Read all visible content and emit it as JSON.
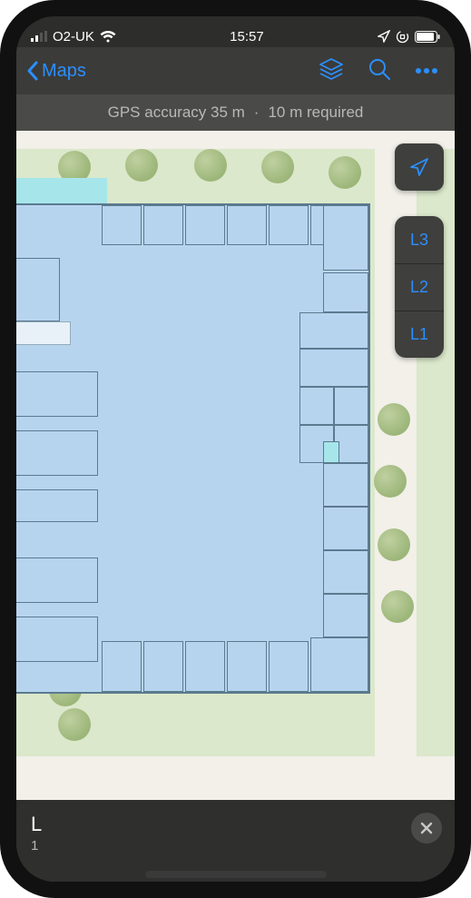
{
  "status": {
    "carrier": "O2-UK",
    "time": "15:57"
  },
  "nav": {
    "back_label": "Maps"
  },
  "banner": {
    "accuracy": "GPS accuracy 35 m",
    "required": "10 m required",
    "separator": "·"
  },
  "controls": {
    "levels": [
      "L3",
      "L2",
      "L1"
    ]
  },
  "sheet": {
    "title": "L",
    "subtitle": "1"
  }
}
